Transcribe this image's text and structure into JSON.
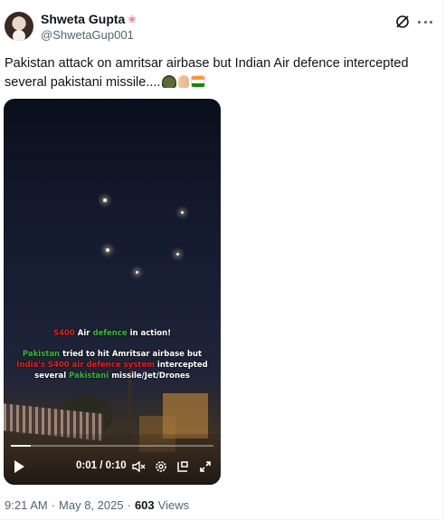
{
  "author": {
    "display_name": "Shweta Gupta",
    "handle": "@ShwetaGup001"
  },
  "tweet": {
    "text": "Pakistan attack on amritsar airbase but Indian Air defence intercepted several pakistani missile....",
    "emojis": [
      "military-helmet",
      "folded-hands",
      "india-flag"
    ]
  },
  "video": {
    "caption_line1": {
      "a": "S400",
      "b": "Air",
      "c": "defence",
      "d": "in action!"
    },
    "caption_line2": {
      "a": "Pakistan",
      "b": "tried to hit Amritsar airbase but"
    },
    "caption_line3": {
      "a": "India's S400 air defence system",
      "b": "intercepted"
    },
    "caption_line4": {
      "a": "several",
      "b": "Pakistani",
      "c": "missile/Jet/Drones"
    },
    "time_display": "0:01 / 0:10",
    "progress": 0.1
  },
  "meta": {
    "time": "9:21 AM",
    "date": "May 8, 2025",
    "views_count": "603",
    "views_label": "Views",
    "separator": "·"
  },
  "colors": {
    "text": "#0f1419",
    "secondary": "#536471",
    "caption_red": "#e0241c",
    "caption_green": "#3db53d"
  }
}
